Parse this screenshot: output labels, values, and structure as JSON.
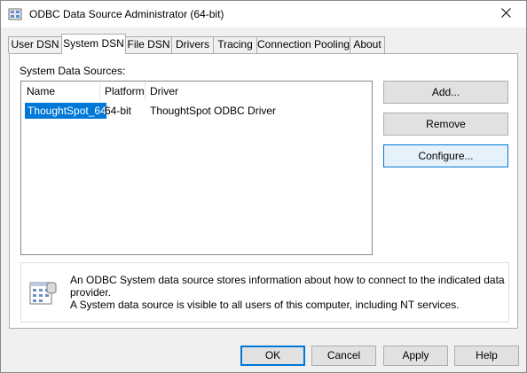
{
  "window": {
    "title": "ODBC Data Source Administrator (64-bit)"
  },
  "tabs": [
    {
      "label": "User DSN",
      "active": false
    },
    {
      "label": "System DSN",
      "active": true
    },
    {
      "label": "File DSN",
      "active": false
    },
    {
      "label": "Drivers",
      "active": false
    },
    {
      "label": "Tracing",
      "active": false
    },
    {
      "label": "Connection Pooling",
      "active": false
    },
    {
      "label": "About",
      "active": false
    }
  ],
  "system_dsn": {
    "list_label": "System Data Sources:",
    "columns": [
      "Name",
      "Platform",
      "Driver"
    ],
    "rows": [
      {
        "name": "ThoughtSpot_64",
        "platform": "64-bit",
        "driver": "ThoughtSpot ODBC Driver",
        "selected": true
      }
    ],
    "buttons": {
      "add": "Add...",
      "remove": "Remove",
      "configure": "Configure..."
    },
    "info": {
      "line1": "An ODBC System data source stores information about how to connect to the indicated data provider.",
      "line2": "A System data source is visible to all users of this computer, including NT services."
    }
  },
  "footer": {
    "ok": "OK",
    "cancel": "Cancel",
    "apply": "Apply",
    "help": "Help"
  },
  "colors": {
    "selection": "#0078d7",
    "focus_border": "#0078d7"
  }
}
